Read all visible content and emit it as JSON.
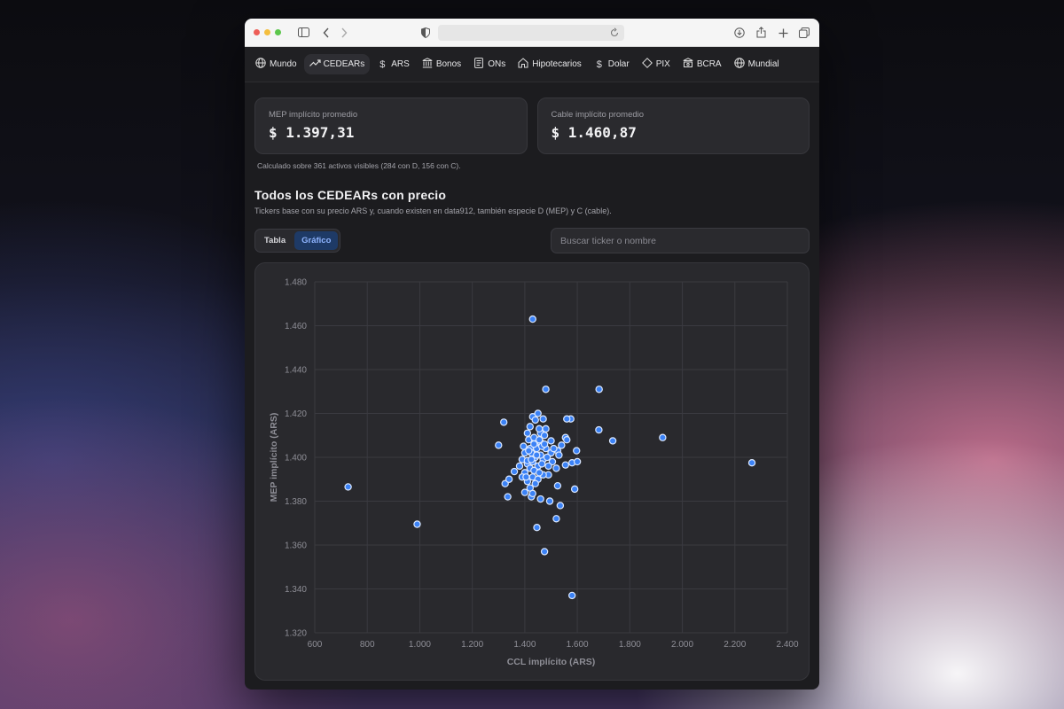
{
  "nav": {
    "items": [
      {
        "label": "Mundo",
        "icon": "globe-icon"
      },
      {
        "label": "CEDEARs",
        "icon": "trending-up-icon",
        "active": true
      },
      {
        "label": "ARS",
        "icon": "dollar-icon"
      },
      {
        "label": "Bonos",
        "icon": "bank-icon"
      },
      {
        "label": "ONs",
        "icon": "document-icon"
      },
      {
        "label": "Hipotecarios",
        "icon": "house-icon"
      },
      {
        "label": "Dolar",
        "icon": "dollar-icon"
      },
      {
        "label": "PIX",
        "icon": "diamond-icon"
      },
      {
        "label": "BCRA",
        "icon": "bank-icon"
      },
      {
        "label": "Mundial",
        "icon": "globe-icon"
      }
    ]
  },
  "cards": {
    "mep": {
      "label": "MEP implícito promedio",
      "value": "$ 1.397,31"
    },
    "cable": {
      "label": "Cable implícito promedio",
      "value": "$ 1.460,87"
    }
  },
  "note": "Calculado sobre 361 activos visibles (284 con D, 156 con C).",
  "section": {
    "title": "Todos los CEDEARs con precio",
    "subtitle": "Tickers base con su precio ARS y, cuando existen en data912, también especie D (MEP) y C (cable)."
  },
  "view_toggle": {
    "table_label": "Tabla",
    "chart_label": "Gráfico",
    "selected": "Gráfico"
  },
  "search": {
    "placeholder": "Buscar ticker o nombre",
    "value": ""
  },
  "colors": {
    "point_fill": "#3b82f6",
    "point_stroke": "#dbe8ff",
    "accent": "#8fb4ff"
  },
  "chart_data": {
    "type": "scatter",
    "xlabel": "CCL implícito (ARS)",
    "ylabel": "MEP implícito (ARS)",
    "xlim": [
      600,
      2400
    ],
    "ylim": [
      1320,
      1480
    ],
    "xticks": [
      "600",
      "800",
      "1.000",
      "1.200",
      "1.400",
      "1.600",
      "1.800",
      "2.000",
      "2.200",
      "2.400"
    ],
    "yticks": [
      "1.320",
      "1.340",
      "1.360",
      "1.380",
      "1.400",
      "1.420",
      "1.440",
      "1.460",
      "1.480"
    ],
    "grid": true,
    "series": [
      {
        "points": [
          [
            727,
            1386.5
          ],
          [
            990,
            1369.5
          ],
          [
            1430,
            1463
          ],
          [
            1480,
            1431
          ],
          [
            1683,
            1431
          ],
          [
            1925,
            1409
          ],
          [
            2265,
            1397.5
          ],
          [
            1682,
            1412.5
          ],
          [
            1735,
            1407.5
          ],
          [
            1300,
            1405.5
          ],
          [
            1320,
            1416
          ],
          [
            1580,
            1337
          ],
          [
            1475,
            1357
          ],
          [
            1446,
            1368
          ],
          [
            1520,
            1372
          ],
          [
            1535,
            1378
          ],
          [
            1495,
            1380
          ],
          [
            1335,
            1382
          ],
          [
            1460,
            1381
          ],
          [
            1425,
            1382
          ],
          [
            1590,
            1385.5
          ],
          [
            1325,
            1388
          ],
          [
            1525,
            1387
          ],
          [
            1340,
            1390
          ],
          [
            1360,
            1393.5
          ],
          [
            1490,
            1392
          ],
          [
            1520,
            1395
          ],
          [
            1555,
            1396.5
          ],
          [
            1580,
            1397.5
          ],
          [
            1600,
            1398
          ],
          [
            1597,
            1403
          ],
          [
            1575,
            1417.5
          ],
          [
            1560,
            1417.5
          ],
          [
            1470,
            1417.5
          ],
          [
            1430,
            1418.5
          ],
          [
            1450,
            1420
          ],
          [
            1440,
            1417
          ],
          [
            1480,
            1413
          ],
          [
            1460,
            1411
          ],
          [
            1410,
            1411
          ],
          [
            1420,
            1414
          ],
          [
            1555,
            1409
          ],
          [
            1560,
            1408
          ],
          [
            1500,
            1407.5
          ],
          [
            1540,
            1405.5
          ],
          [
            1525,
            1403
          ],
          [
            1500,
            1402
          ],
          [
            1480,
            1404
          ],
          [
            1440,
            1406
          ],
          [
            1460,
            1407
          ],
          [
            1420,
            1404
          ],
          [
            1400,
            1402
          ],
          [
            1390,
            1399
          ],
          [
            1410,
            1397
          ],
          [
            1430,
            1398
          ],
          [
            1450,
            1396
          ],
          [
            1470,
            1399
          ],
          [
            1460,
            1401
          ],
          [
            1440,
            1400
          ],
          [
            1420,
            1395
          ],
          [
            1400,
            1393
          ],
          [
            1390,
            1391
          ],
          [
            1410,
            1389
          ],
          [
            1430,
            1391
          ],
          [
            1450,
            1390
          ],
          [
            1470,
            1392
          ],
          [
            1440,
            1388
          ],
          [
            1420,
            1386
          ],
          [
            1400,
            1384
          ],
          [
            1430,
            1383.5
          ],
          [
            1410,
            1398.5
          ],
          [
            1425,
            1402
          ],
          [
            1445,
            1404
          ],
          [
            1465,
            1405
          ],
          [
            1485,
            1400
          ],
          [
            1505,
            1398
          ],
          [
            1395,
            1405
          ],
          [
            1415,
            1408
          ],
          [
            1435,
            1409
          ],
          [
            1455,
            1413
          ],
          [
            1475,
            1410
          ],
          [
            1490,
            1396
          ],
          [
            1380,
            1396
          ],
          [
            1435,
            1394
          ],
          [
            1455,
            1393
          ],
          [
            1405,
            1391
          ],
          [
            1425,
            1399
          ],
          [
            1445,
            1401
          ],
          [
            1465,
            1397
          ],
          [
            1415,
            1403
          ],
          [
            1435,
            1406
          ],
          [
            1455,
            1408
          ],
          [
            1475,
            1406
          ],
          [
            1510,
            1404
          ],
          [
            1530,
            1401
          ]
        ]
      }
    ]
  }
}
